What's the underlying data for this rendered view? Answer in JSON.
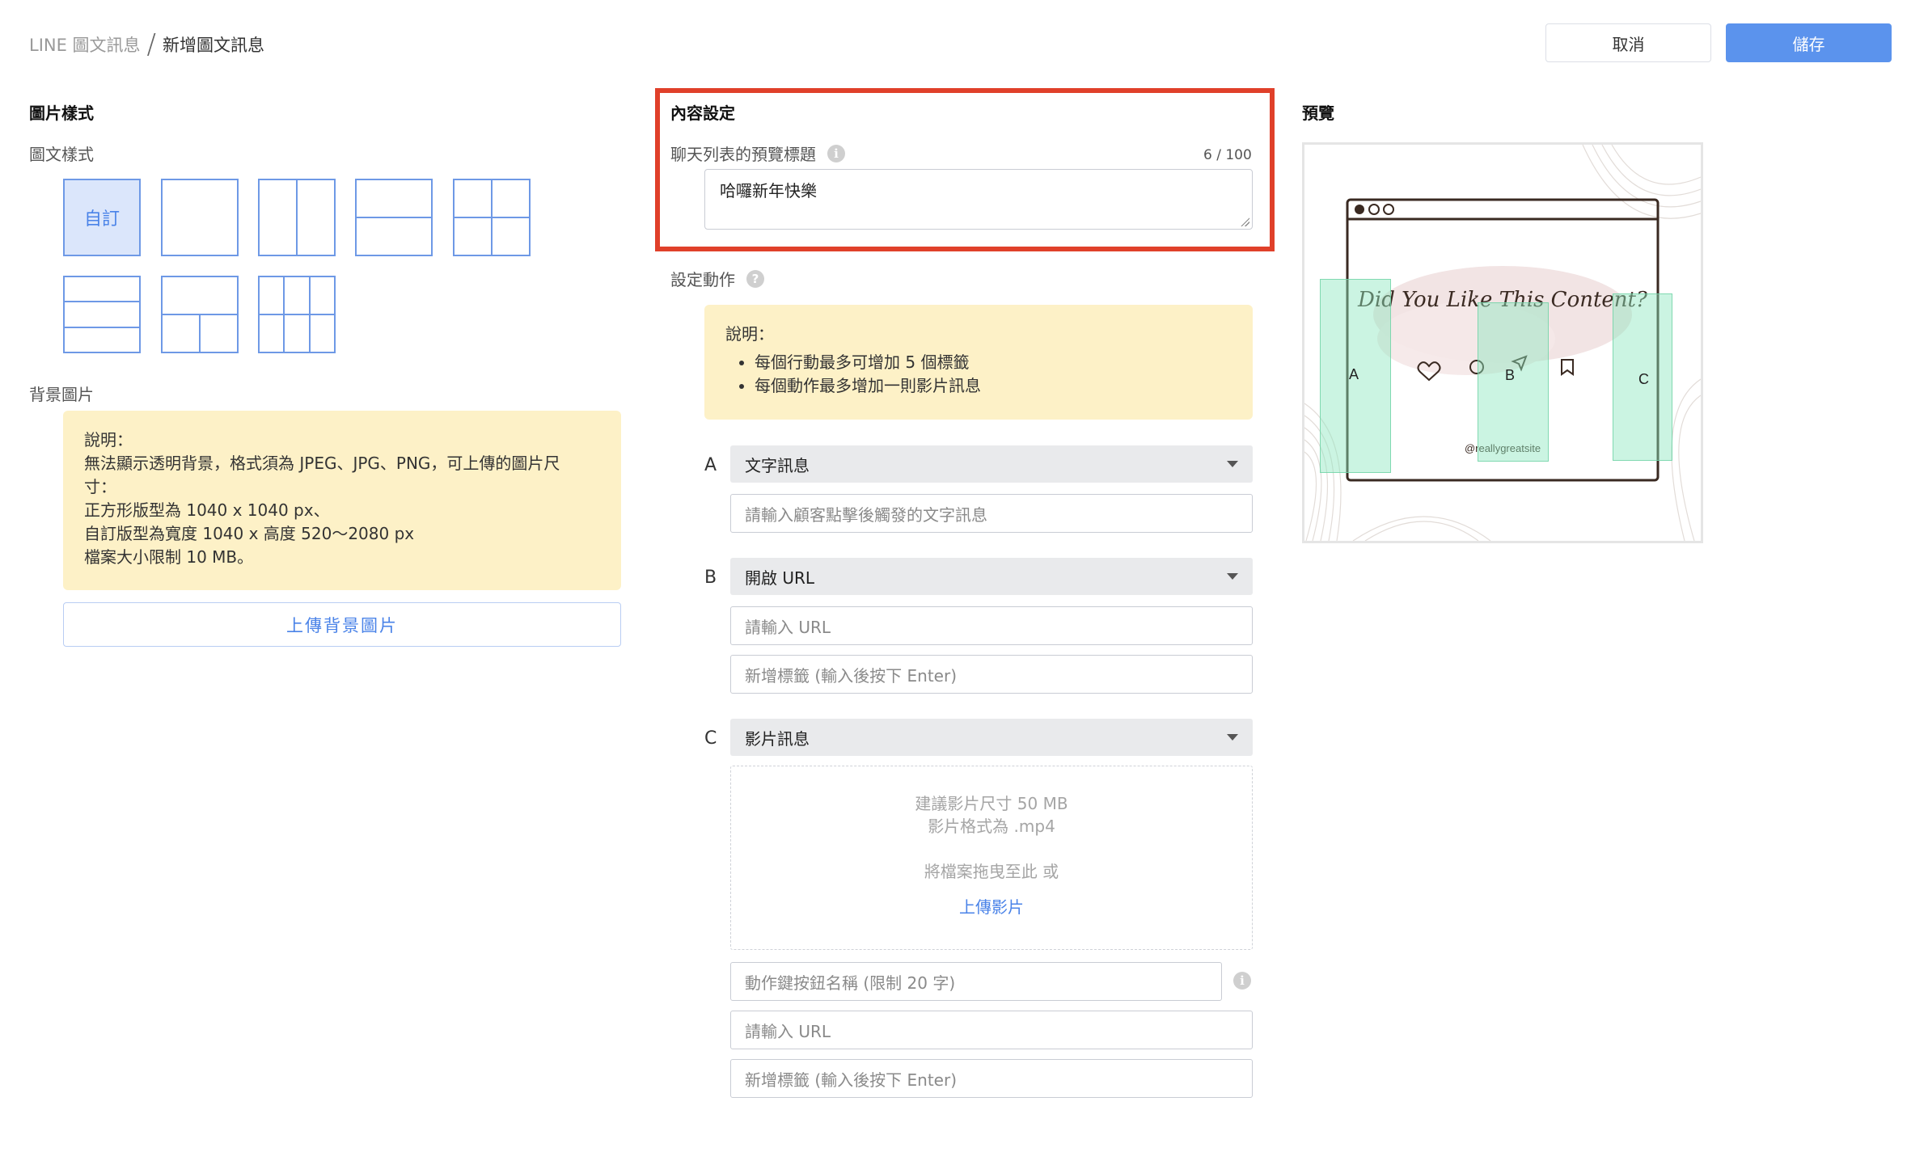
{
  "header": {
    "breadcrumb_parent": "LINE 圖文訊息",
    "breadcrumb_sep": "/",
    "breadcrumb_current": "新增圖文訊息",
    "cancel_label": "取消",
    "save_label": "儲存"
  },
  "image_style": {
    "section_title": "圖片樣式",
    "layout_label": "圖文樣式",
    "custom_label": "自訂",
    "background_label": "背景圖片",
    "note_title": "說明：",
    "note_line1": "無法顯示透明背景，格式須為 JPEG、JPG、PNG，可上傳的圖片尺",
    "note_line2": "寸：",
    "note_line3": "正方形版型為 1040 x 1040 px、",
    "note_line4": "自訂版型為寬度 1040 x 高度 520～2080 px",
    "note_line5": "檔案大小限制 10 MB。",
    "upload_label": "上傳背景圖片"
  },
  "content": {
    "section_title": "內容設定",
    "preview_title_label": "聊天列表的預覽標題",
    "char_count": "6 / 100",
    "preview_title_value": "哈囉新年快樂",
    "actions_label": "設定動作",
    "actions_note_title": "說明：",
    "actions_note_items": [
      "每個行動最多可增加 5 個標籤",
      "每個動作最多增加一則影片訊息"
    ],
    "slots": [
      {
        "letter": "A",
        "type": "文字訊息",
        "text_placeholder": "請輸入顧客點擊後觸發的文字訊息"
      },
      {
        "letter": "B",
        "type": "開啟 URL",
        "url_placeholder": "請輸入 URL",
        "tag_placeholder": "新增標籤 (輸入後按下 Enter)"
      },
      {
        "letter": "C",
        "type": "影片訊息",
        "drop_line1": "建議影片尺寸 50 MB",
        "drop_line2": "影片格式為 .mp4",
        "drop_line3": "將檔案拖曳至此 或",
        "upload_video": "上傳影片",
        "button_name_placeholder": "動作鍵按鈕名稱 (限制 20 字)",
        "url_placeholder": "請輸入 URL",
        "tag_placeholder": "新增標籤 (輸入後按下 Enter)"
      }
    ]
  },
  "preview": {
    "section_title": "預覽",
    "image_heading": "Did You Like This Content?",
    "image_handle": "@reallygreatsite",
    "area_labels": [
      "A",
      "B",
      "C"
    ]
  },
  "colors": {
    "primary": "#5b93ed",
    "highlight_border": "#e0402a",
    "note_background": "#fdf1c7",
    "tap_area": "#8ce6be"
  }
}
